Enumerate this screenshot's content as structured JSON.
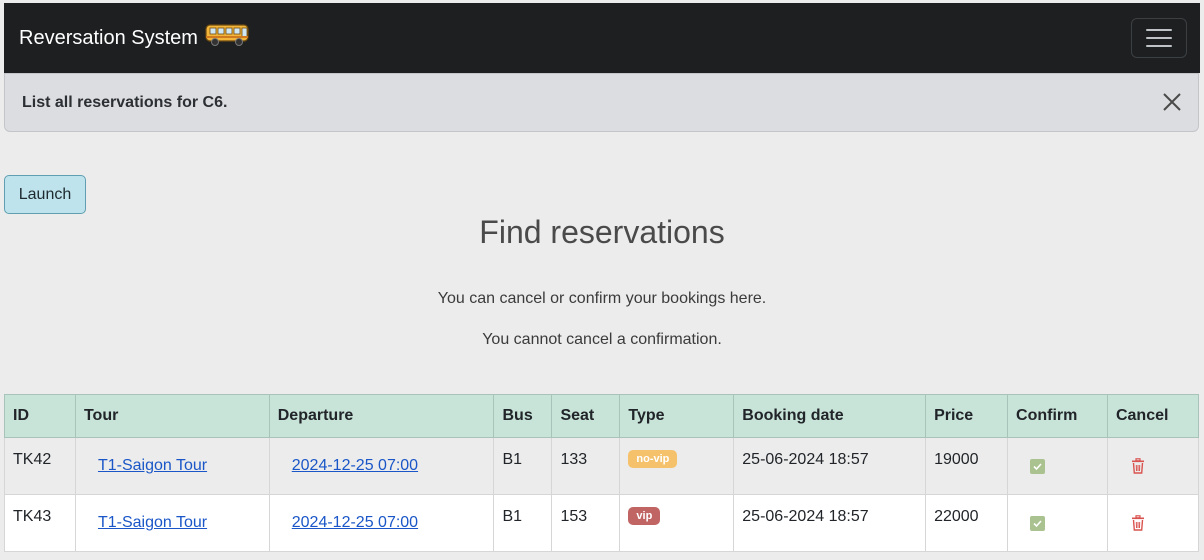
{
  "navbar": {
    "brand": "Reversation System",
    "brand_icon": "bus-icon",
    "menu_icon": "hamburger-menu-icon"
  },
  "alert": {
    "message": "List all reservations for C6.",
    "close_icon": "close-icon"
  },
  "launch_button": "Launch",
  "page": {
    "title": "Find reservations",
    "info_line_1": "You can cancel or confirm your bookings here.",
    "info_line_2": "You cannot cancel a confirmation."
  },
  "table": {
    "headers": [
      "ID",
      "Tour",
      "Departure",
      "Bus",
      "Seat",
      "Type",
      "Booking date",
      "Price",
      "Confirm",
      "Cancel"
    ],
    "rows": [
      {
        "id": "TK42",
        "tour": "T1-Saigon Tour",
        "departure": "2024-12-25 07:00",
        "bus": "B1",
        "seat": "133",
        "type": "no-vip",
        "booking_date": "25-06-2024 18:57",
        "price": "19000"
      },
      {
        "id": "TK43",
        "tour": "T1-Saigon Tour",
        "departure": "2024-12-25 07:00",
        "bus": "B1",
        "seat": "153",
        "type": "vip",
        "booking_date": "25-06-2024 18:57",
        "price": "22000"
      }
    ]
  },
  "colors": {
    "navbar_bg": "#1d1f21",
    "header_bg": "#c8e3d8",
    "link": "#1a56c7",
    "badge_no_vip": "#f5c26b",
    "badge_vip": "#c06464",
    "confirm": "#a9c28f",
    "cancel": "#d9534f"
  }
}
